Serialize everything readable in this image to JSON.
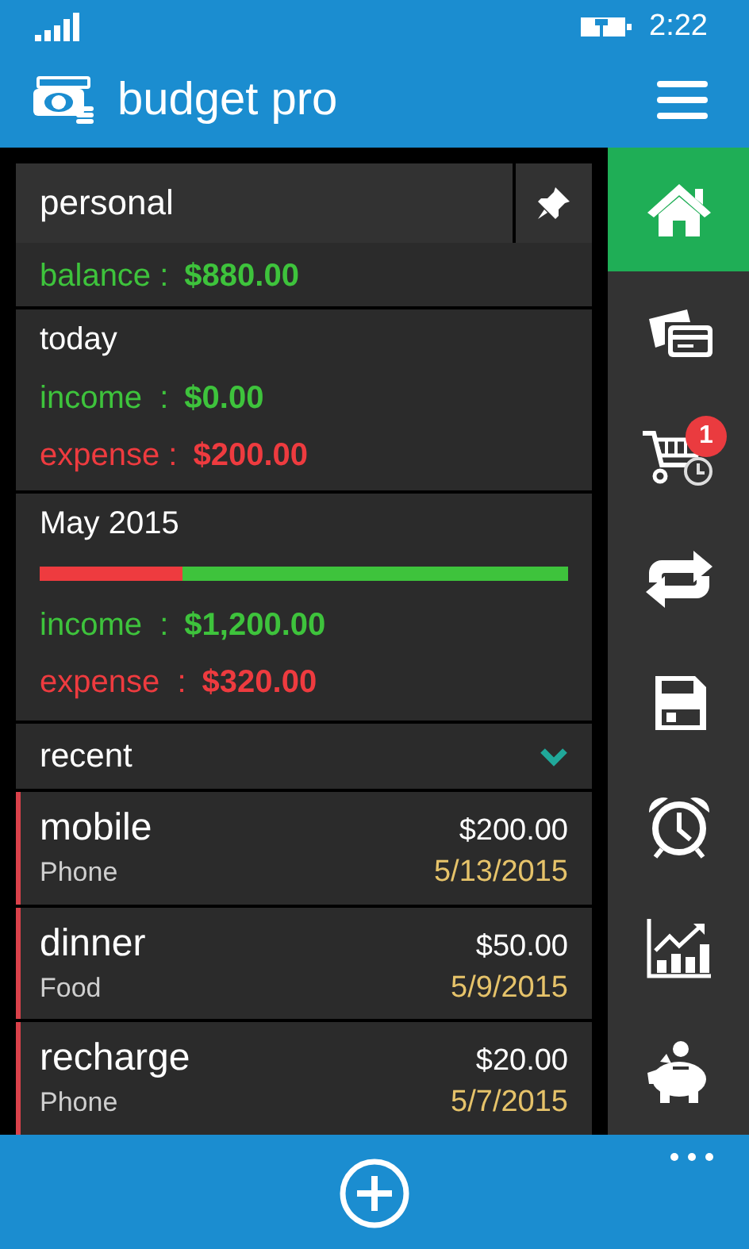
{
  "status_bar": {
    "time": "2:22"
  },
  "app": {
    "title": "budget pro"
  },
  "account": {
    "name": "personal",
    "balance_label": "balance :",
    "balance": "$880.00"
  },
  "today": {
    "title": "today",
    "income_label": "income  :",
    "income": "$0.00",
    "expense_label": "expense :",
    "expense": "$200.00"
  },
  "month": {
    "title": "May 2015",
    "level": 0.27,
    "income_label": "income  :",
    "income": "$1,200.00",
    "expense_label": "expense  :",
    "expense": "$320.00"
  },
  "recent": {
    "title": "recent",
    "expanded": true,
    "items": [
      {
        "name": "mobile",
        "category": "Phone",
        "amount": "$200.00",
        "date": "5/13/2015"
      },
      {
        "name": "dinner",
        "category": "Food",
        "amount": "$50.00",
        "date": "5/9/2015"
      },
      {
        "name": "recharge",
        "category": "Phone",
        "amount": "$20.00",
        "date": "5/7/2015"
      }
    ]
  },
  "nav": [
    {
      "kind": "home",
      "selected": true
    },
    {
      "kind": "cards",
      "selected": false
    },
    {
      "kind": "cart",
      "selected": false,
      "badge": "1"
    },
    {
      "kind": "repeat",
      "selected": false
    },
    {
      "kind": "save",
      "selected": false
    },
    {
      "kind": "alarm",
      "selected": false
    },
    {
      "kind": "chart",
      "selected": false
    },
    {
      "kind": "piggy",
      "selected": false
    }
  ]
}
